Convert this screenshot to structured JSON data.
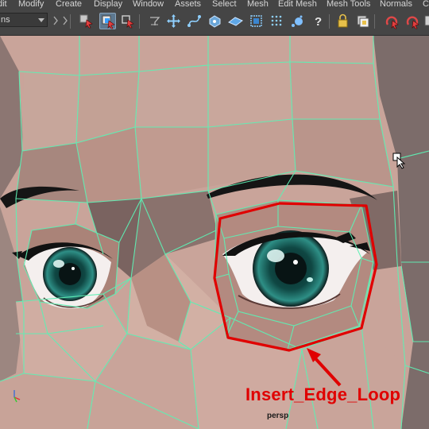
{
  "menubar": {
    "items": [
      "dit",
      "Modify",
      "Create",
      "Display",
      "Window",
      "Assets",
      "Select",
      "Mesh",
      "Edit Mesh",
      "Mesh Tools",
      "Normals",
      "C"
    ]
  },
  "toolbar": {
    "mode_select_value": "ns",
    "icons": [
      "move-tool-icon",
      "select-hierarchy-icon",
      "select-object-icon",
      "select-component-icon",
      "snap-to-grid-icon",
      "snap-to-curve-icon",
      "snap-to-point-icon",
      "snap-to-view-plane-icon",
      "make-live-icon",
      "history-icon",
      "lock-icon",
      "render-frame-icon",
      "ipr-render-icon",
      "render-settings-icon",
      "hypershade-icon",
      "help-icon"
    ]
  },
  "viewport": {
    "camera": "persp",
    "annotation": "Insert_Edge_Loop",
    "wire_color": "#5ef0b4",
    "highlight_color": "#e00000"
  }
}
